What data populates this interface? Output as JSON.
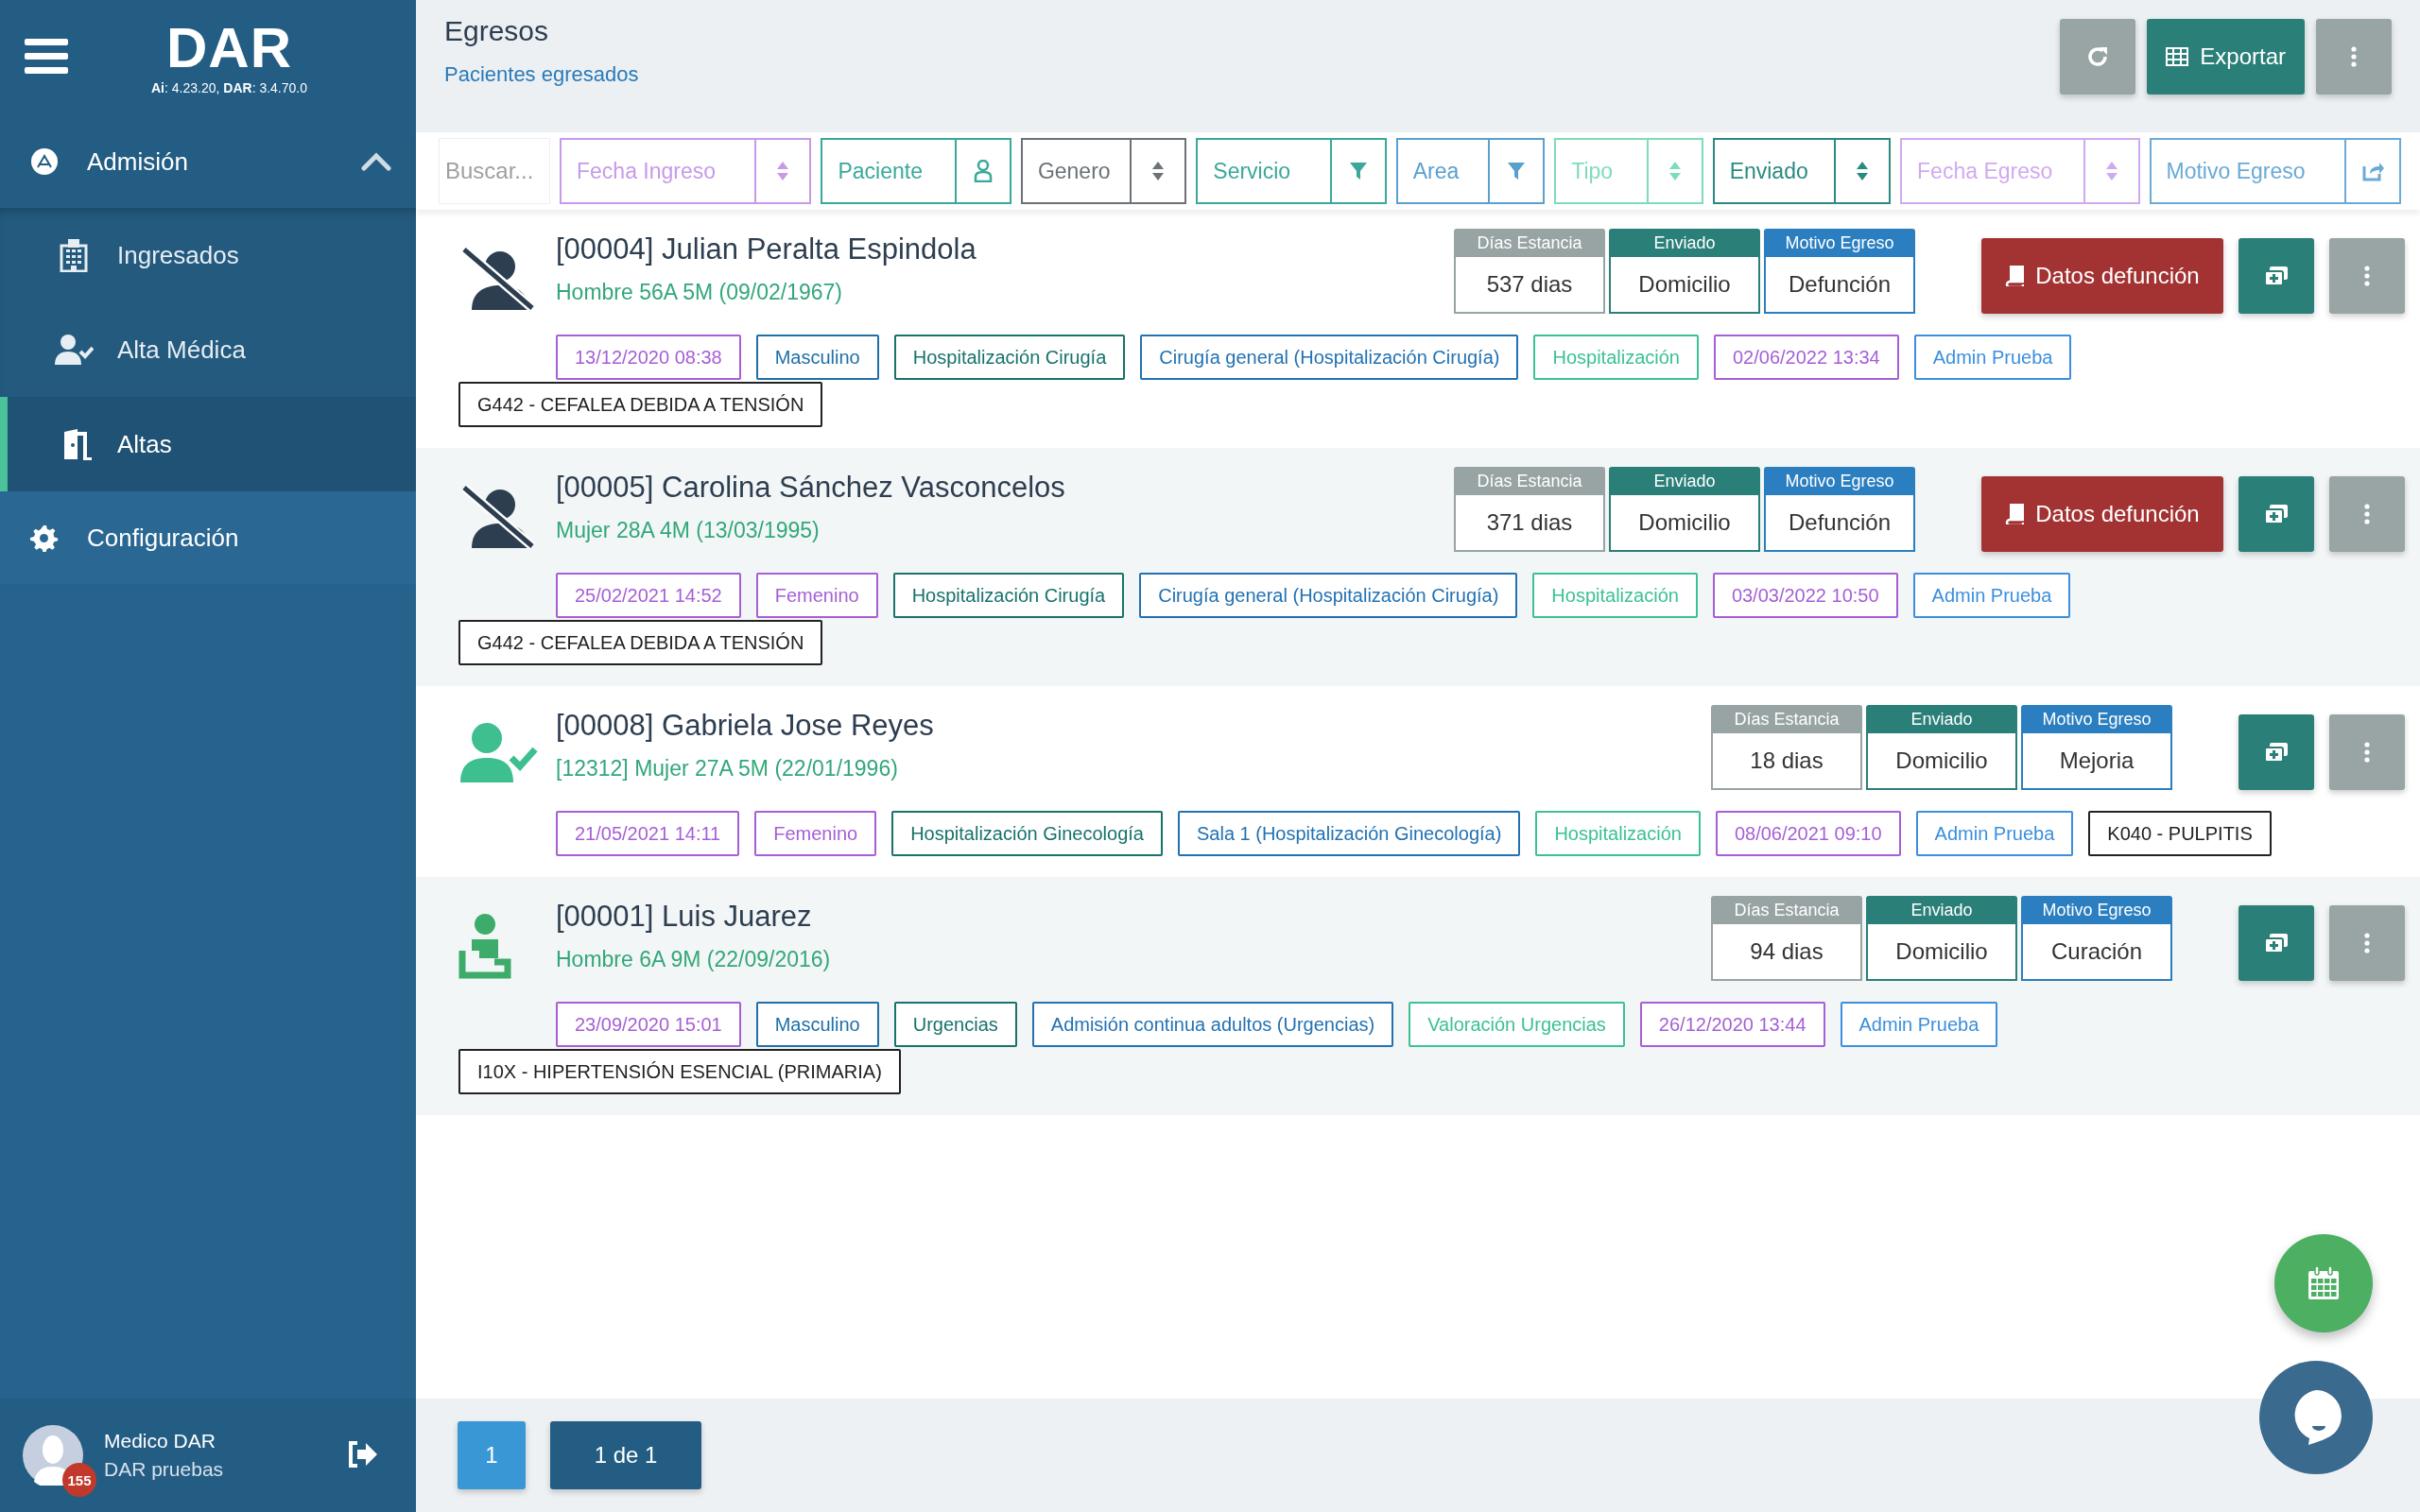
{
  "sidebar": {
    "logo": "DAR",
    "version": "**Ai**: 4.23.20, **DAR**: 3.4.70.0",
    "items": [
      {
        "label": "Admisión",
        "expanded": true,
        "children": [
          {
            "label": "Ingresados",
            "selected": false
          },
          {
            "label": "Alta Médica",
            "selected": false
          },
          {
            "label": "Altas",
            "selected": true
          }
        ]
      },
      {
        "label": "Configuración",
        "selected": false
      }
    ],
    "user": {
      "name": "Medico DAR",
      "org": "DAR pruebas",
      "badge": "155"
    }
  },
  "header": {
    "title": "Egresos",
    "subtitle": "Pacientes egresados",
    "export_button": "Exportar"
  },
  "filters": {
    "search_placeholder": "Buscar...",
    "fields": [
      {
        "placeholder": "Fecha Ingreso",
        "kind": "sort",
        "color": "#c69ae8"
      },
      {
        "placeholder": "Paciente",
        "kind": "person",
        "color": "#3aa89a"
      },
      {
        "placeholder": "Genero",
        "kind": "sort",
        "color": "#6b7378"
      },
      {
        "placeholder": "Servicio",
        "kind": "filter",
        "color": "#3aa89a"
      },
      {
        "placeholder": "Area",
        "kind": "filter",
        "color": "#5aa0cf"
      },
      {
        "placeholder": "Tipo",
        "kind": "sort",
        "color": "#7fdcba"
      },
      {
        "placeholder": "Enviado",
        "kind": "sort",
        "color": "#2a8a80"
      },
      {
        "placeholder": "Fecha Egreso",
        "kind": "sort",
        "color": "#d0aaf0"
      },
      {
        "placeholder": "Motivo Egreso",
        "kind": "export",
        "color": "#6aaad6"
      }
    ]
  },
  "patients": [
    {
      "kind": "deceased",
      "title": "[00004] Julian Peralta Espindola",
      "subtitle": "Hombre 56A 5M (09/02/1967)",
      "stats": [
        {
          "label": "Días Estancia",
          "value": "537 dias",
          "color": "#98a3a3"
        },
        {
          "label": "Enviado",
          "value": "Domicilio",
          "color": "#2a7f78"
        },
        {
          "label": "Motivo Egreso",
          "value": "Defunción",
          "color": "#2b7fc0"
        }
      ],
      "death_button": "Datos defunción",
      "chips": [
        {
          "text": "13/12/2020 08:38",
          "color": "#a65fd6"
        },
        {
          "text": "Masculino",
          "color": "#1f6fa8"
        },
        {
          "text": "Hospitalización Cirugía",
          "color": "#17736b"
        },
        {
          "text": "Cirugía general (Hospitalización Cirugía)",
          "color": "#2272b3"
        },
        {
          "text": "Hospitalización",
          "color": "#3cc196"
        },
        {
          "text": "02/06/2022 13:34",
          "color": "#a65fd6"
        },
        {
          "text": "Admin Prueba",
          "color": "#3b8fde"
        },
        {
          "text": "G442 - CEFALEA DEBIDA A TENSIÓN",
          "color": "#222222"
        }
      ]
    },
    {
      "kind": "deceased",
      "title": "[00005] Carolina Sánchez Vasconcelos",
      "subtitle": "Mujer 28A 4M (13/03/1995)",
      "stats": [
        {
          "label": "Días Estancia",
          "value": "371 dias",
          "color": "#98a3a3"
        },
        {
          "label": "Enviado",
          "value": "Domicilio",
          "color": "#2a7f78"
        },
        {
          "label": "Motivo Egreso",
          "value": "Defunción",
          "color": "#2b7fc0"
        }
      ],
      "death_button": "Datos defunción",
      "chips": [
        {
          "text": "25/02/2021 14:52",
          "color": "#a65fd6"
        },
        {
          "text": "Femenino",
          "color": "#a65fd6"
        },
        {
          "text": "Hospitalización Cirugía",
          "color": "#17736b"
        },
        {
          "text": "Cirugía general (Hospitalización Cirugía)",
          "color": "#2272b3"
        },
        {
          "text": "Hospitalización",
          "color": "#3cc196"
        },
        {
          "text": "03/03/2022 10:50",
          "color": "#a65fd6"
        },
        {
          "text": "Admin Prueba",
          "color": "#3b8fde"
        },
        {
          "text": "G442 - CEFALEA DEBIDA A TENSIÓN",
          "color": "#222222"
        }
      ]
    },
    {
      "kind": "recovered",
      "title": "[00008] Gabriela Jose Reyes",
      "subtitle": "[12312] Mujer 27A 5M (22/01/1996)",
      "stats": [
        {
          "label": "Días Estancia",
          "value": "18 dias",
          "color": "#98a3a3"
        },
        {
          "label": "Enviado",
          "value": "Domicilio",
          "color": "#2a7f78"
        },
        {
          "label": "Motivo Egreso",
          "value": "Mejoria",
          "color": "#2b7fc0"
        }
      ],
      "chips": [
        {
          "text": "21/05/2021 14:11",
          "color": "#a65fd6"
        },
        {
          "text": "Femenino",
          "color": "#a65fd6"
        },
        {
          "text": "Hospitalización Ginecología",
          "color": "#17736b"
        },
        {
          "text": "Sala 1 (Hospitalización Ginecología)",
          "color": "#2272b3"
        },
        {
          "text": "Hospitalización",
          "color": "#3cc196"
        },
        {
          "text": "08/06/2021 09:10",
          "color": "#a65fd6"
        },
        {
          "text": "Admin Prueba",
          "color": "#3b8fde"
        },
        {
          "text": "K040 - PULPITIS",
          "color": "#222222"
        }
      ]
    },
    {
      "kind": "seated",
      "title": "[00001] Luis Juarez",
      "subtitle": "Hombre 6A 9M (22/09/2016)",
      "stats": [
        {
          "label": "Días Estancia",
          "value": "94 dias",
          "color": "#98a3a3"
        },
        {
          "label": "Enviado",
          "value": "Domicilio",
          "color": "#2a7f78"
        },
        {
          "label": "Motivo Egreso",
          "value": "Curación",
          "color": "#2b7fc0"
        }
      ],
      "chips": [
        {
          "text": "23/09/2020 15:01",
          "color": "#a65fd6"
        },
        {
          "text": "Masculino",
          "color": "#1f6fa8"
        },
        {
          "text": "Urgencias",
          "color": "#17736b"
        },
        {
          "text": "Admisión continua adultos (Urgencias)",
          "color": "#2272b3"
        },
        {
          "text": "Valoración Urgencias",
          "color": "#3cc196"
        },
        {
          "text": "26/12/2020 13:44",
          "color": "#a65fd6"
        },
        {
          "text": "Admin Prueba",
          "color": "#3b8fde"
        },
        {
          "text": "I10X - HIPERTENSIÓN ESENCIAL (PRIMARIA)",
          "color": "#222222"
        }
      ]
    }
  ],
  "pagination": {
    "pages": [
      {
        "label": "1",
        "selected": true
      }
    ],
    "summary": "1 de 1"
  }
}
